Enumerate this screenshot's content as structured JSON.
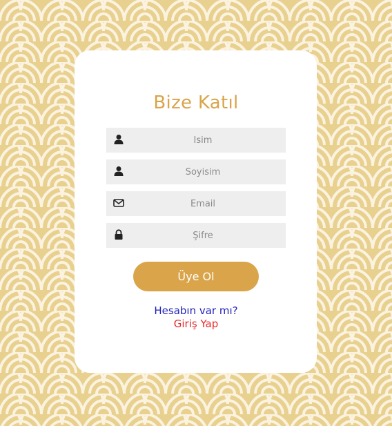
{
  "form": {
    "title": "Bize Katıl",
    "fields": [
      {
        "name": "isim",
        "placeholder": "İsim",
        "icon": "user-icon"
      },
      {
        "name": "soyisim",
        "placeholder": "Soyisim",
        "icon": "user-icon"
      },
      {
        "name": "email",
        "placeholder": "Email",
        "icon": "envelope-icon"
      },
      {
        "name": "sifre",
        "placeholder": "Şifre",
        "icon": "lock-icon"
      }
    ],
    "submit_label": "Üye Ol",
    "account_question": "Hesabın var mı?",
    "login_link": "Giriş Yap"
  },
  "colors": {
    "accent": "#d9a44a",
    "background_pattern": "#e8d08f",
    "link_blue": "#2222bb",
    "link_red": "#e52a2a"
  }
}
